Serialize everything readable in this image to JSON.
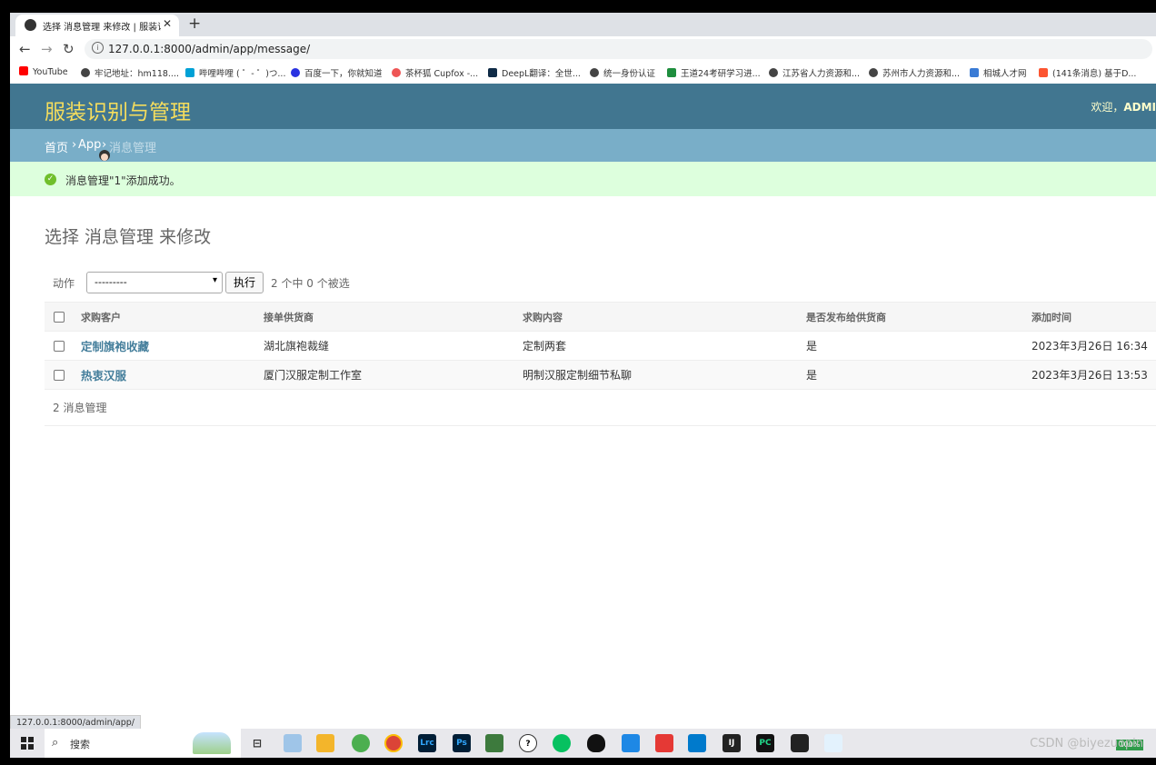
{
  "browser": {
    "tab_title": "选择 消息管理 来修改 | 服装识别与管理",
    "tab_close": "✕",
    "new_tab": "+",
    "url": "127.0.0.1:8000/admin/app/message/",
    "bookmarks": [
      "YouTube",
      "牢记地址：hm118....",
      "哔哩哔哩 ( ゜- ゜)つ...",
      "百度一下，你就知道",
      "茶杯狐 Cupfox -...",
      "DeepL翻译：全世...",
      "统一身份认证",
      "王道24考研学习进...",
      "江苏省人力资源和...",
      "苏州市人力资源和...",
      "相城人才网",
      "(141条消息) 基于D..."
    ],
    "status_url": "127.0.0.1:8000/admin/app/"
  },
  "header": {
    "brand": "服装识别与管理",
    "welcome": "欢迎，",
    "user": "ADMI"
  },
  "breadcrumbs": {
    "home": "首页",
    "app": "App",
    "current": "消息管理",
    "sep": "›"
  },
  "message": {
    "text": "消息管理\"1\"添加成功。"
  },
  "page": {
    "title": "选择 消息管理 来修改"
  },
  "actions": {
    "label": "动作",
    "selected": "---------",
    "go": "执行",
    "count": "2 个中 0 个被选"
  },
  "table": {
    "headers": [
      "求购客户",
      "接单供货商",
      "求购内容",
      "是否发布给供货商",
      "添加时间"
    ],
    "rows": [
      [
        "定制旗袍收藏",
        "湖北旗袍裁缝",
        "定制两套",
        "是",
        "2023年3月26日 16:34"
      ],
      [
        "热衷汉服",
        "厦门汉服定制工作室",
        "明制汉服定制细节私聊",
        "是",
        "2023年3月26日 13:53"
      ]
    ]
  },
  "paginator": {
    "text": "2 消息管理"
  },
  "taskbar": {
    "search": "搜索",
    "battery": "100%",
    "watermark": "CSDN @biyezuopin"
  }
}
